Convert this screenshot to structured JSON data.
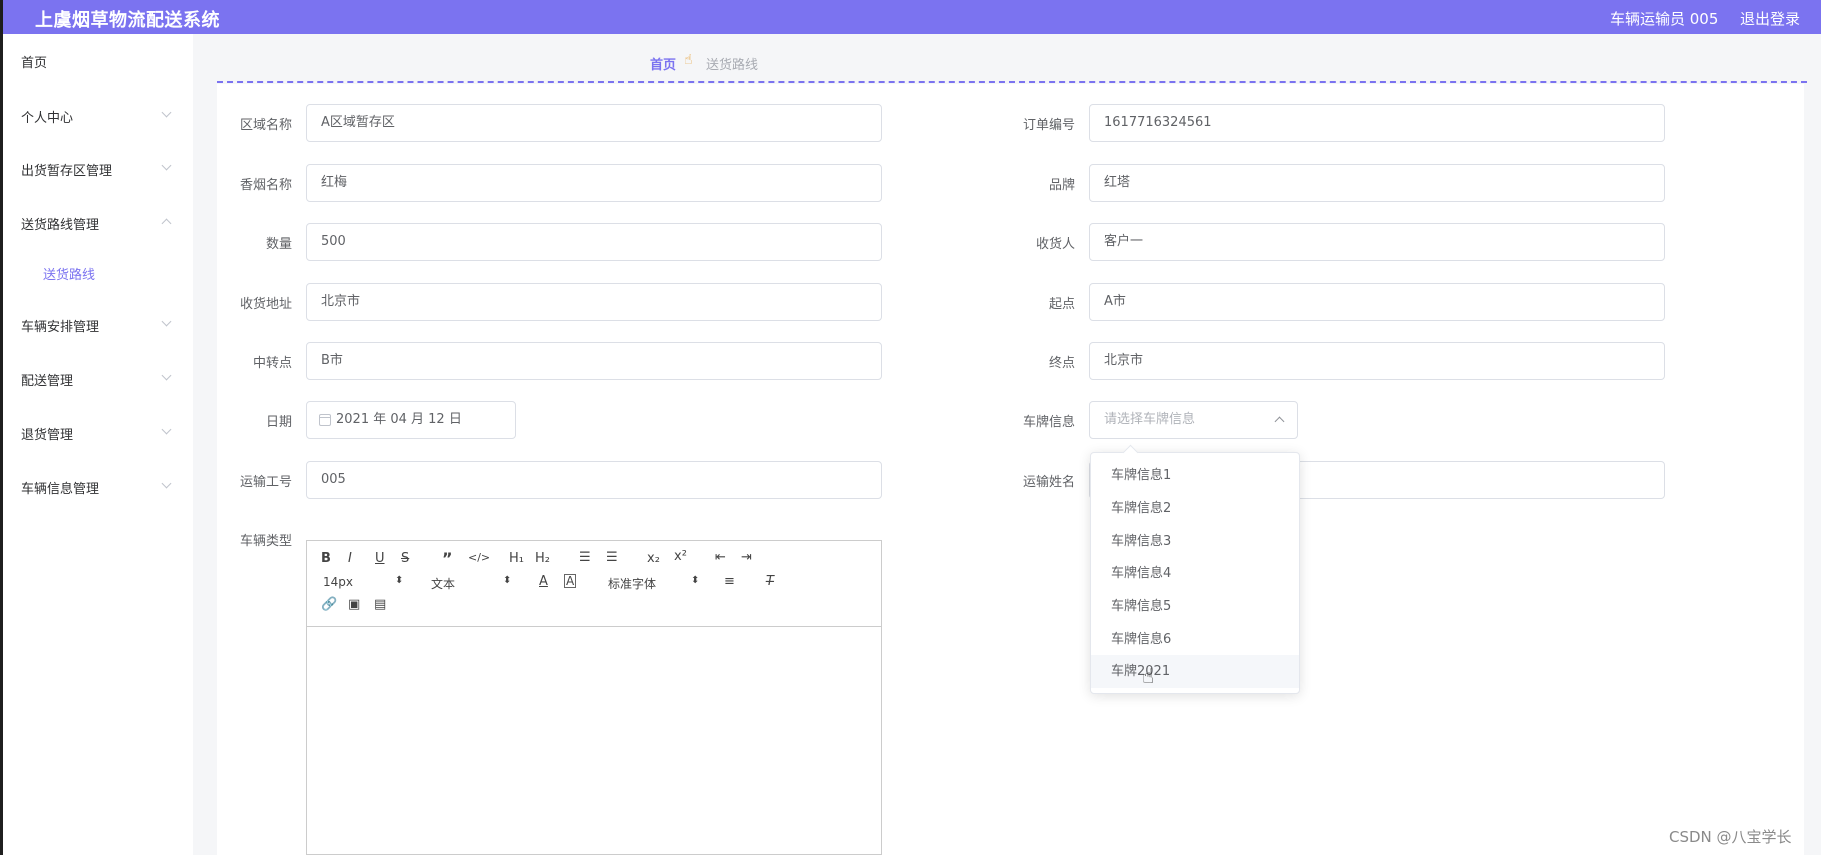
{
  "header": {
    "title": "上虞烟草物流配送系统",
    "user": "车辆运输员 005",
    "logout": "退出登录"
  },
  "sidebar": {
    "items": [
      {
        "label": "首页"
      },
      {
        "label": "个人中心"
      },
      {
        "label": "出货暂存区管理"
      },
      {
        "label": "送货路线管理"
      },
      {
        "label": "车辆安排管理"
      },
      {
        "label": "配送管理"
      },
      {
        "label": "退货管理"
      },
      {
        "label": "车辆信息管理"
      }
    ],
    "sub_item": "送货路线"
  },
  "breadcrumb": {
    "home": "首页",
    "separator_icon": "hand-icon",
    "current": "送货路线"
  },
  "form": {
    "area_label": "区域名称",
    "area_value": "A区域暂存区",
    "order_label": "订单编号",
    "order_value": "1617716324561",
    "cig_label": "香烟名称",
    "cig_value": "红梅",
    "brand_label": "品牌",
    "brand_value": "红塔",
    "qty_label": "数量",
    "qty_value": "500",
    "receiver_label": "收货人",
    "receiver_value": "客户一",
    "addr_label": "收货地址",
    "addr_value": "北京市",
    "start_label": "起点",
    "start_value": "A市",
    "transfer_label": "中转点",
    "transfer_value": "B市",
    "end_label": "终点",
    "end_value": "北京市",
    "date_label": "日期",
    "date_value": "2021 年 04 月 12 日",
    "plate_label": "车牌信息",
    "plate_placeholder": "请选择车牌信息",
    "worker_id_label": "运输工号",
    "worker_id_value": "005",
    "worker_name_label": "运输姓名",
    "vehicle_type_label": "车辆类型"
  },
  "dropdown": {
    "options": [
      "车牌信息1",
      "车牌信息2",
      "车牌信息3",
      "车牌信息4",
      "车牌信息5",
      "车牌信息6",
      "车牌2021"
    ],
    "hovered": "车牌2021"
  },
  "editor": {
    "font_size": "14px",
    "text_style": "文本",
    "font_family": "标准字体"
  },
  "watermark": "CSDN @八宝学长",
  "colors": {
    "accent": "#7b73f0"
  }
}
